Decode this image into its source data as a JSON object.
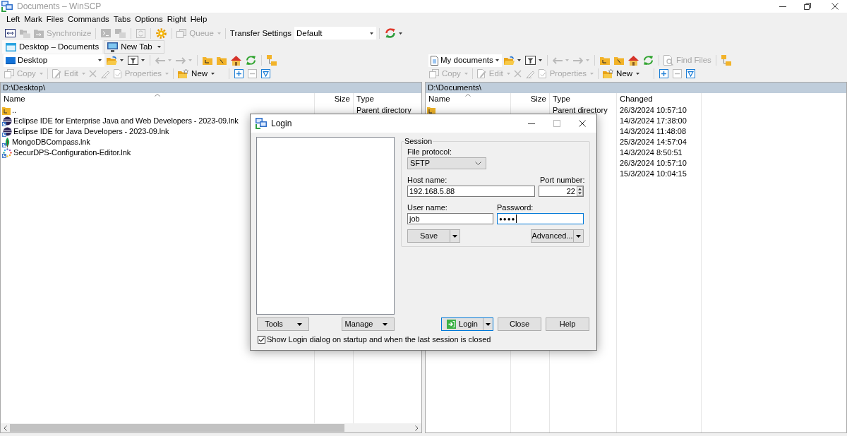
{
  "window": {
    "title": "Documents – WinSCP",
    "active": false
  },
  "menu": [
    "Left",
    "Mark",
    "Files",
    "Commands",
    "Tabs",
    "Options",
    "Right",
    "Help"
  ],
  "toolbar": [
    {
      "kind": "button",
      "disabled": false
    },
    {
      "kind": "button",
      "disabled": true
    },
    {
      "kind": "button",
      "label": "Synchronize",
      "disabled": true
    },
    {
      "kind": "button",
      "disabled": true
    },
    {
      "kind": "button",
      "disabled": true
    },
    {
      "kind": "button",
      "disabled": true
    },
    {
      "kind": "button",
      "disabled": false
    },
    {
      "kind": "menu",
      "label": "Queue",
      "disabled": true
    },
    {
      "kind": "label",
      "label": "Transfer Settings"
    },
    {
      "kind": "combo",
      "value": "Default"
    },
    {
      "kind": "menu",
      "disabled": false
    }
  ],
  "tabs": [
    {
      "kind": "session",
      "label": "Desktop – Documents",
      "selected": true
    },
    {
      "kind": "new",
      "label": "New Tab",
      "selected": false
    }
  ],
  "panels": [
    {
      "location": "Desktop",
      "navigation": [
        {
          "kind": "menu",
          "disabled": false
        },
        {
          "kind": "menu",
          "disabled": false
        },
        {
          "kind": "menu",
          "disabled": true
        },
        {
          "kind": "menu",
          "disabled": true
        },
        {
          "kind": "button",
          "disabled": false
        },
        {
          "kind": "button",
          "disabled": false
        },
        {
          "kind": "button",
          "disabled": false
        },
        {
          "kind": "button",
          "disabled": false
        },
        {
          "kind": "button",
          "disabled": false
        }
      ],
      "commands": [
        {
          "kind": "menu",
          "label": "Copy",
          "disabled": true
        },
        {
          "kind": "menu",
          "label": "Edit",
          "disabled": true
        },
        {
          "kind": "button",
          "disabled": true
        },
        {
          "kind": "button",
          "disabled": true
        },
        {
          "kind": "menu",
          "label": "Properties",
          "disabled": true
        },
        {
          "kind": "menu",
          "label": "New",
          "disabled": false
        },
        {
          "kind": "button",
          "disabled": false
        },
        {
          "kind": "button",
          "disabled": true
        },
        {
          "kind": "button",
          "disabled": false
        }
      ],
      "path": "D:\\Desktop\\",
      "columns": [
        {
          "label": "Name",
          "sorted": true
        },
        {
          "label": "Size",
          "sorted": false
        },
        {
          "label": "Type",
          "sorted": false
        }
      ],
      "rows": [
        {
          "kind": "parent",
          "name": "..",
          "type": "Parent directory"
        },
        {
          "kind": "shortcut",
          "name": "Eclipse IDE for Enterprise Java and Web Developers - 2023-09.lnk"
        },
        {
          "kind": "shortcut",
          "name": "Eclipse IDE for Java Developers - 2023-09.lnk"
        },
        {
          "kind": "shortcut",
          "name": "MongoDBCompass.lnk"
        },
        {
          "kind": "shortcut",
          "name": "SecurDPS-Configuration-Editor.lnk"
        }
      ]
    },
    {
      "location": "My documents",
      "navigation": [
        {
          "kind": "menu",
          "disabled": false
        },
        {
          "kind": "menu",
          "disabled": false
        },
        {
          "kind": "menu",
          "disabled": true
        },
        {
          "kind": "menu",
          "disabled": true
        },
        {
          "kind": "button",
          "disabled": false
        },
        {
          "kind": "button",
          "disabled": false
        },
        {
          "kind": "button",
          "disabled": false
        },
        {
          "kind": "button",
          "disabled": false
        },
        {
          "kind": "button",
          "disabled": false
        }
      ],
      "find_files": {
        "label": "Find Files",
        "disabled": true
      },
      "commands": [
        {
          "kind": "menu",
          "label": "Copy",
          "disabled": true
        },
        {
          "kind": "menu",
          "label": "Edit",
          "disabled": true
        },
        {
          "kind": "button",
          "disabled": true
        },
        {
          "kind": "button",
          "disabled": true
        },
        {
          "kind": "menu",
          "label": "Properties",
          "disabled": true
        },
        {
          "kind": "menu",
          "label": "New",
          "disabled": false
        },
        {
          "kind": "button",
          "disabled": false
        },
        {
          "kind": "button",
          "disabled": true
        },
        {
          "kind": "button",
          "disabled": false
        }
      ],
      "path": "D:\\Documents\\",
      "columns": [
        {
          "label": "Name",
          "sorted": true
        },
        {
          "label": "Size",
          "sorted": false
        },
        {
          "label": "Type",
          "sorted": false
        },
        {
          "label": "Changed",
          "sorted": false
        }
      ],
      "rows": [
        {
          "kind": "parent",
          "type": "Parent directory",
          "changed": "26/3/2024 10:57:10"
        },
        {
          "changed": "14/3/2024 17:38:00"
        },
        {
          "changed": "14/3/2024 11:48:08"
        },
        {
          "changed": "25/3/2024 14:57:04"
        },
        {
          "changed": "14/3/2024 8:50:51"
        },
        {
          "changed": "26/3/2024 10:57:10"
        },
        {
          "changed": "15/3/2024 10:04:15"
        }
      ]
    }
  ],
  "login_dialog": {
    "title": "Login",
    "controls": [
      {
        "kind": "minimize",
        "disabled": false
      },
      {
        "kind": "maximize",
        "disabled": true
      },
      {
        "kind": "close",
        "disabled": false
      }
    ],
    "session": {
      "title": "Session",
      "file_protocol": {
        "label": "File protocol:",
        "value": "SFTP"
      },
      "host_name": {
        "label": "Host name:",
        "value": "192.168.5.88",
        "focused": false
      },
      "port_number": {
        "label": "Port number:",
        "value": "22",
        "focused": false
      },
      "user_name": {
        "label": "User name:",
        "value": "job",
        "focused": false
      },
      "password": {
        "label": "Password:",
        "value": "●●●●",
        "focused": true
      },
      "buttons": [
        {
          "kind": "split",
          "label": "Save"
        },
        {
          "kind": "split",
          "label": "Advanced..."
        }
      ]
    },
    "site_buttons": [
      {
        "kind": "menu",
        "label": "Tools"
      },
      {
        "kind": "menu",
        "label": "Manage"
      }
    ],
    "buttons": [
      {
        "kind": "split",
        "label": "Login",
        "default": true
      },
      {
        "kind": "plain",
        "label": "Close",
        "default": false
      },
      {
        "kind": "plain",
        "label": "Help",
        "default": false
      }
    ],
    "show_on_startup": {
      "label": "Show Login dialog on startup and when the last session is closed",
      "checked": true
    }
  }
}
